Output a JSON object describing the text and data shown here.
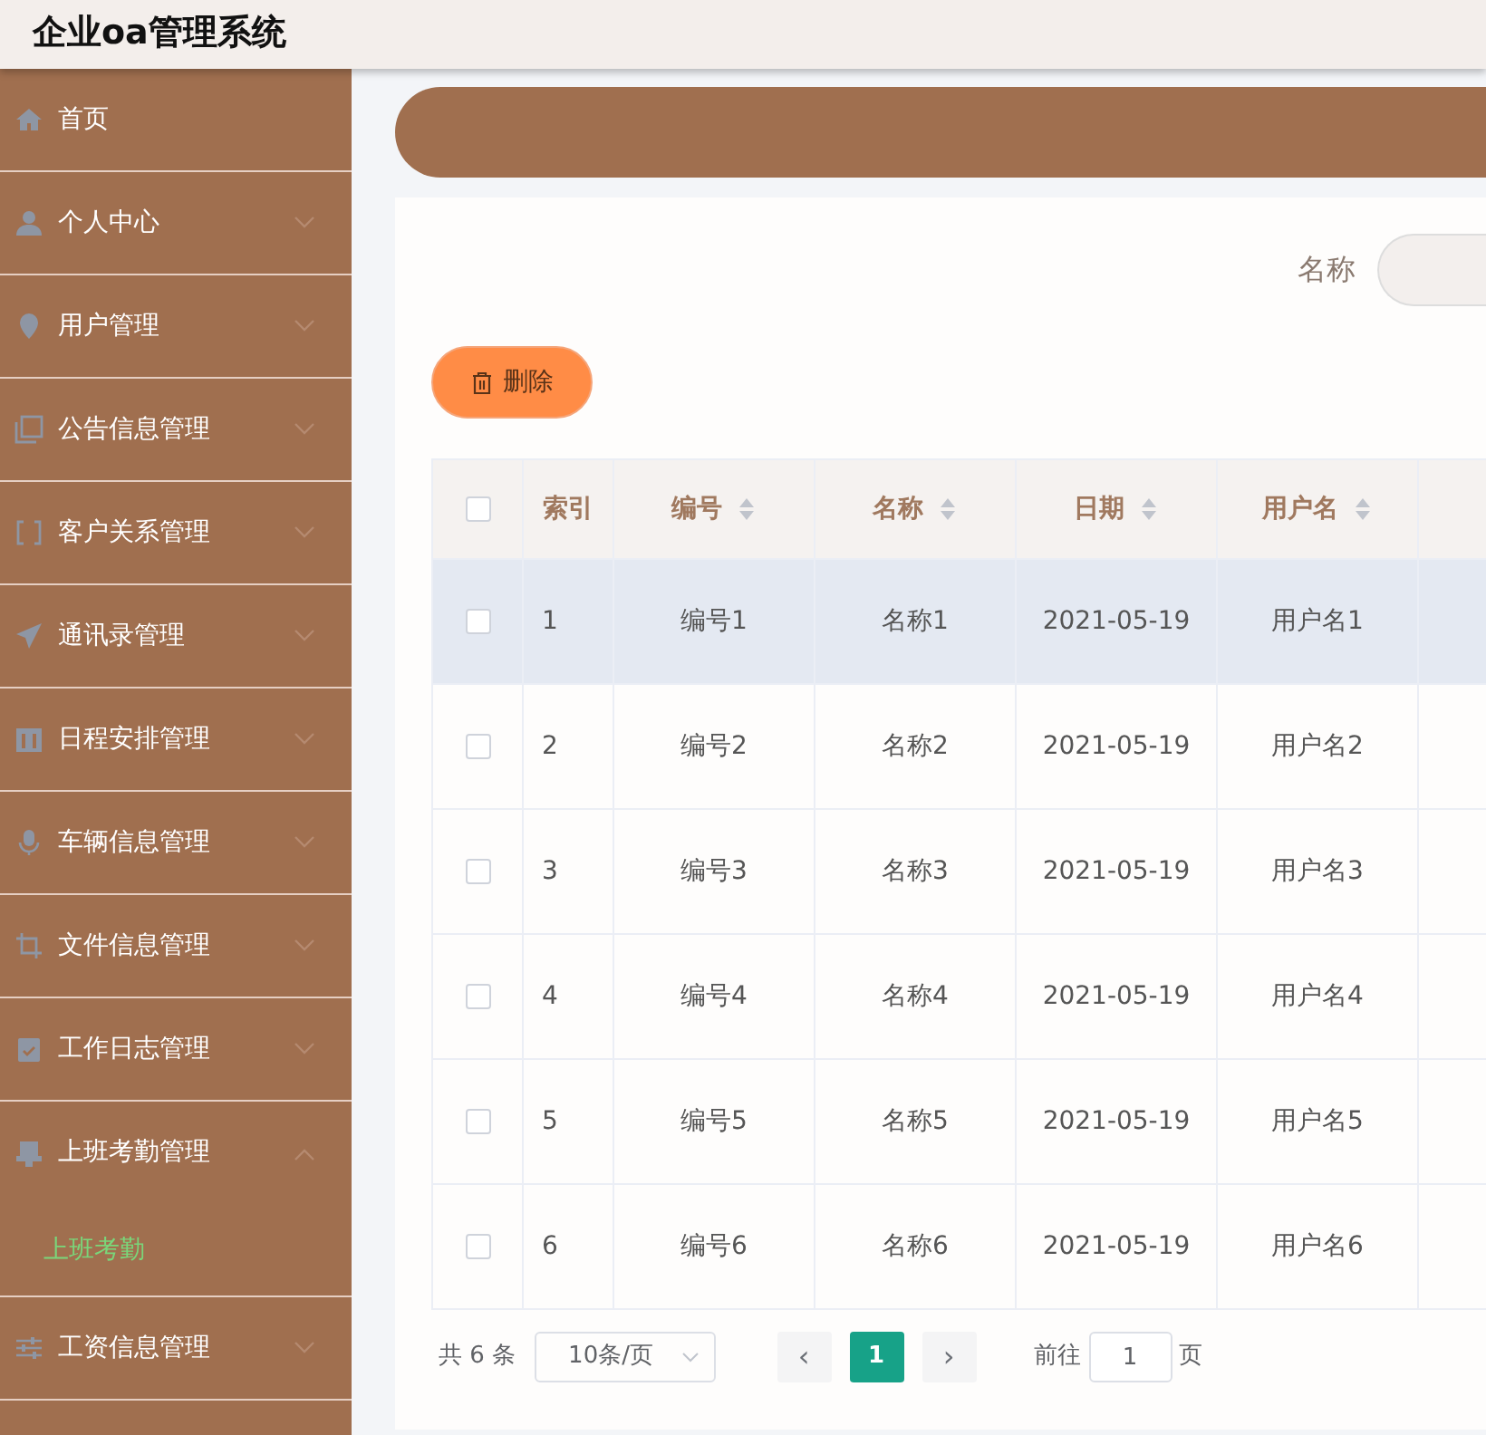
{
  "header": {
    "title": "企业oa管理系统"
  },
  "sidebar": {
    "items": [
      {
        "label": "首页",
        "kind": "link"
      },
      {
        "label": "个人中心",
        "kind": "menu",
        "expanded": false
      },
      {
        "label": "用户管理",
        "kind": "menu",
        "expanded": false
      },
      {
        "label": "公告信息管理",
        "kind": "menu",
        "expanded": false
      },
      {
        "label": "客户关系管理",
        "kind": "menu",
        "expanded": false
      },
      {
        "label": "通讯录管理",
        "kind": "menu",
        "expanded": false
      },
      {
        "label": "日程安排管理",
        "kind": "menu",
        "expanded": false
      },
      {
        "label": "车辆信息管理",
        "kind": "menu",
        "expanded": false
      },
      {
        "label": "文件信息管理",
        "kind": "menu",
        "expanded": false
      },
      {
        "label": "工作日志管理",
        "kind": "menu",
        "expanded": false
      },
      {
        "label": "上班考勤管理",
        "kind": "menu",
        "expanded": true,
        "children": [
          {
            "label": "上班考勤",
            "selected": true
          }
        ]
      },
      {
        "label": "工资信息管理",
        "kind": "menu",
        "expanded": false
      }
    ]
  },
  "search": {
    "label": "名称"
  },
  "delete_button": "删除",
  "table": {
    "select_all": false,
    "columns": [
      {
        "label": "索引",
        "sortable": false
      },
      {
        "label": "编号",
        "sortable": true
      },
      {
        "label": "名称",
        "sortable": true
      },
      {
        "label": "日期",
        "sortable": true
      },
      {
        "label": "用户名",
        "sortable": true
      }
    ],
    "rows": [
      {
        "checked": false,
        "highlighted": true,
        "cells": [
          "1",
          "编号1",
          "名称1",
          "2021-05-19",
          "用户名1"
        ]
      },
      {
        "checked": false,
        "highlighted": false,
        "cells": [
          "2",
          "编号2",
          "名称2",
          "2021-05-19",
          "用户名2"
        ]
      },
      {
        "checked": false,
        "highlighted": false,
        "cells": [
          "3",
          "编号3",
          "名称3",
          "2021-05-19",
          "用户名3"
        ]
      },
      {
        "checked": false,
        "highlighted": false,
        "cells": [
          "4",
          "编号4",
          "名称4",
          "2021-05-19",
          "用户名4"
        ]
      },
      {
        "checked": false,
        "highlighted": false,
        "cells": [
          "5",
          "编号5",
          "名称5",
          "2021-05-19",
          "用户名5"
        ]
      },
      {
        "checked": false,
        "highlighted": false,
        "cells": [
          "6",
          "编号6",
          "名称6",
          "2021-05-19",
          "用户名6"
        ]
      }
    ]
  },
  "pagination": {
    "total": "共 6 条",
    "page_size": "10条/页",
    "prev": "‹",
    "pages": [
      {
        "label": "1",
        "selected": true
      }
    ],
    "next": "›",
    "goto_label": "前往",
    "goto_value": "1",
    "goto_suffix": "页"
  }
}
